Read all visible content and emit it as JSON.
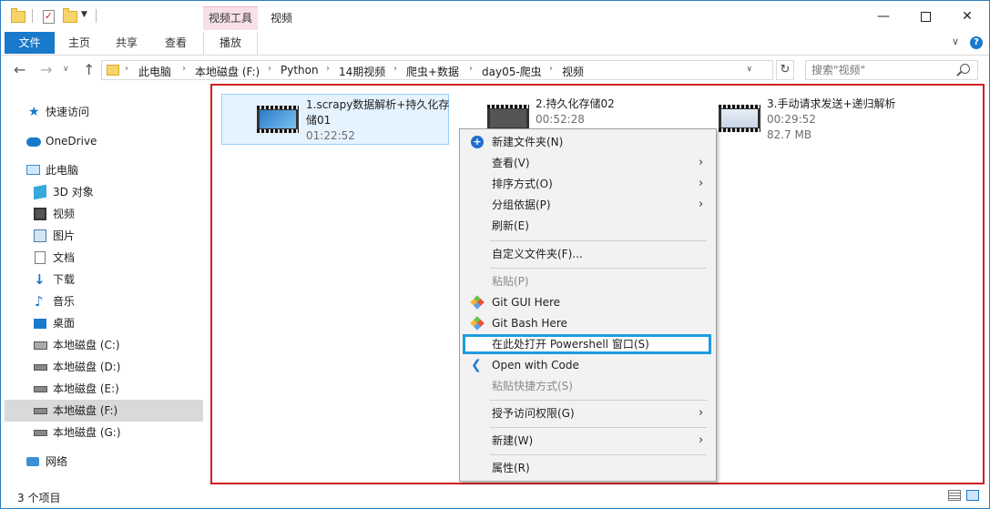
{
  "window": {
    "title": "视频",
    "contextual_tab_group": "视频工具",
    "controls": {
      "minimize": "—",
      "maximize": "",
      "close": "✕"
    }
  },
  "ribbon": {
    "tabs": [
      {
        "label": "文件"
      },
      {
        "label": "主页"
      },
      {
        "label": "共享"
      },
      {
        "label": "查看"
      },
      {
        "label": "播放"
      }
    ],
    "collapse_caret": "∨",
    "help": "?"
  },
  "nav": {
    "back": "←",
    "forward": "→",
    "recent": "∨",
    "up": "↑",
    "refresh": "↻",
    "address_dropdown": "∨",
    "breadcrumbs": [
      "此电脑",
      "本地磁盘 (F:)",
      "Python",
      "14期视频",
      "爬虫+数据",
      "day05-爬虫",
      "视频"
    ],
    "crumb_separator": "›",
    "search_placeholder": "搜索\"视频\""
  },
  "sidebar": {
    "items": [
      {
        "label": "快速访问",
        "icon": "star-icon"
      },
      {
        "label": "OneDrive",
        "icon": "cloud-icon"
      },
      {
        "label": "此电脑",
        "icon": "computer-icon"
      },
      {
        "label": "3D 对象",
        "icon": "3d-objects-icon"
      },
      {
        "label": "视频",
        "icon": "video-folder-icon"
      },
      {
        "label": "图片",
        "icon": "pictures-icon"
      },
      {
        "label": "文档",
        "icon": "documents-icon"
      },
      {
        "label": "下载",
        "icon": "download-icon"
      },
      {
        "label": "音乐",
        "icon": "music-icon"
      },
      {
        "label": "桌面",
        "icon": "desktop-icon"
      },
      {
        "label": "本地磁盘 (C:)",
        "icon": "system-drive-icon"
      },
      {
        "label": "本地磁盘 (D:)",
        "icon": "drive-icon"
      },
      {
        "label": "本地磁盘 (E:)",
        "icon": "drive-icon"
      },
      {
        "label": "本地磁盘 (F:)",
        "icon": "drive-icon",
        "selected": true
      },
      {
        "label": "本地磁盘 (G:)",
        "icon": "drive-icon"
      },
      {
        "label": "网络",
        "icon": "network-icon"
      }
    ]
  },
  "files": [
    {
      "name_line1": "1.scrapy数据解析+持久化存",
      "name_line2": "储01",
      "duration": "01:22:52"
    },
    {
      "name_line1": "2.持久化存储02",
      "duration": "00:52:28"
    },
    {
      "name_line1": "3.手动请求发送+递归解析",
      "duration": "00:29:52",
      "size": "82.7 MB"
    }
  ],
  "context_menu": {
    "new_folder": "新建文件夹(N)",
    "view": "查看(V)",
    "sort_by": "排序方式(O)",
    "group_by": "分组依据(P)",
    "refresh": "刷新(E)",
    "customize": "自定义文件夹(F)...",
    "paste": "粘贴(P)",
    "git_gui": "Git GUI Here",
    "git_bash": "Git Bash Here",
    "powershell": "在此处打开 Powershell 窗口(S)",
    "open_code": "Open with Code",
    "paste_shortcut": "粘贴快捷方式(S)",
    "grant_access": "授予访问权限(G)",
    "new": "新建(W)",
    "properties": "属性(R)",
    "submenu_arrow": "›"
  },
  "status": {
    "count": "3 个项目"
  },
  "colors": {
    "accent": "#1979ca",
    "highlight_box": "#1d9be0",
    "annotation_red": "#d01f1f"
  }
}
